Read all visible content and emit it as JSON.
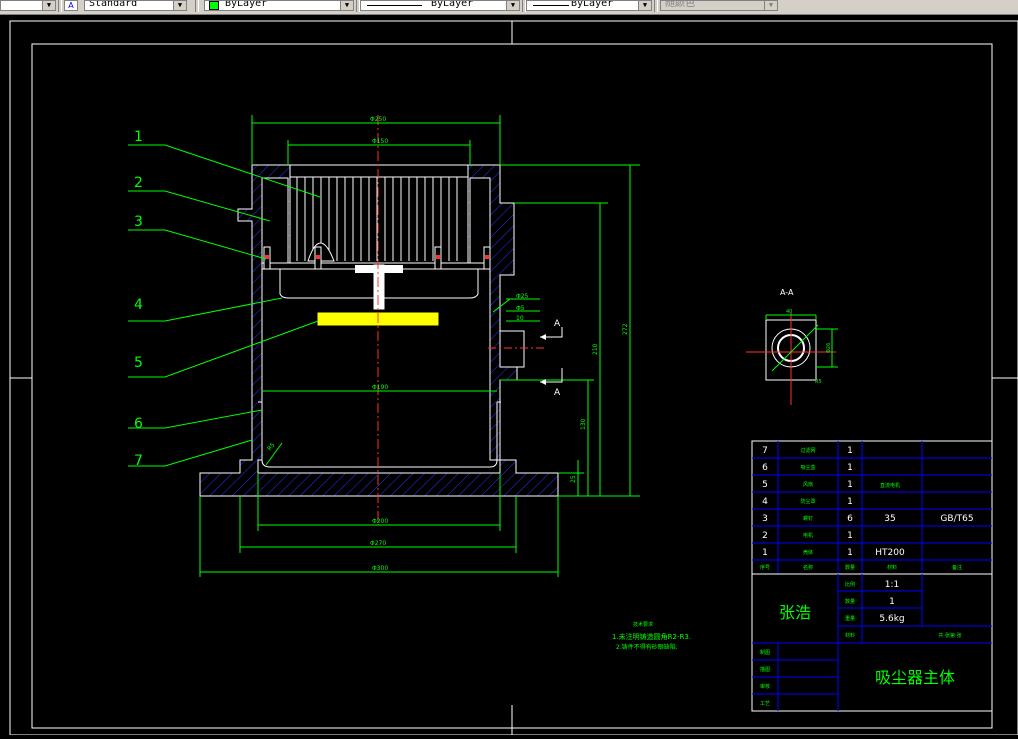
{
  "toolbar": {
    "style_value": "Standard",
    "color_value": "ByLayer",
    "linetype_value": "ByLayer",
    "lineweight_value": "ByLayer",
    "plotstyle_value": "随颜色",
    "color_swatch": "#00ff00"
  },
  "drawing": {
    "part_callouts": [
      "1",
      "2",
      "3",
      "4",
      "5",
      "6",
      "7"
    ],
    "section_title": "A-A",
    "section_marks": [
      "A",
      "A"
    ],
    "dimensions": {
      "top_width": "Φ250",
      "inner_top": "Φ150",
      "mid_bore": "Φ190",
      "bottom_inner": "Φ200",
      "bottom_outer": "Φ270",
      "base_width": "Φ300",
      "h_total": "272",
      "h_mid": "210",
      "h_low": "130",
      "h_base": "25",
      "side_a": "Φ25",
      "side_b": "Φ5",
      "side_c": "10",
      "sec_w": "40",
      "sec_d": "Φ26",
      "sec_r": "R5",
      "bowl_r": "R5"
    },
    "notes": {
      "heading": "技术要求",
      "line1": "1.未注明铸造圆角R2-R3.",
      "line2": "2.铸件不得有砂眼缺陷."
    }
  },
  "parts_list": {
    "rows": [
      {
        "no": "7",
        "name": "过滤网",
        "qty": "1",
        "material": "",
        "standard": ""
      },
      {
        "no": "6",
        "name": "吸尘盒",
        "qty": "1",
        "material": "",
        "standard": ""
      },
      {
        "no": "5",
        "name": "风扇",
        "qty": "1",
        "material": "",
        "standard": ""
      },
      {
        "no": "4",
        "name": "防尘罩",
        "qty": "1",
        "material": "",
        "standard": ""
      },
      {
        "no": "3",
        "name": "螺钉",
        "qty": "6",
        "material": "35",
        "standard": "GB/T65"
      },
      {
        "no": "2",
        "name": "电机",
        "qty": "1",
        "material": "",
        "standard": ""
      },
      {
        "no": "1",
        "name": "壳体",
        "qty": "1",
        "material": "HT200",
        "standard": ""
      }
    ],
    "header": {
      "no": "序号",
      "name": "名称",
      "qty": "数量",
      "material": "材料",
      "remark": "备注"
    }
  },
  "title_block": {
    "designer": "张浩",
    "scale_label": "比例",
    "scale": "1:1",
    "qty_label": "数量",
    "qty": "1",
    "weight_label": "重量",
    "weight": "5.6kg",
    "material_label": "材料",
    "sheet": "共 张第 张",
    "title": "吸尘器主体",
    "roles": [
      "制图",
      "描图",
      "审核",
      "工艺"
    ]
  }
}
